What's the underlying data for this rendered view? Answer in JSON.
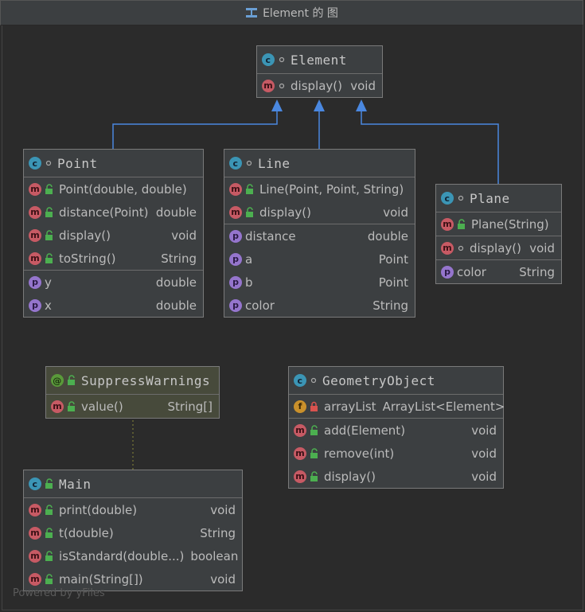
{
  "window": {
    "title": "Element 的 图"
  },
  "footer": {
    "text": "Powered by yFiles"
  },
  "colors": {
    "edge_inherit": "#4a88e0",
    "edge_dep": "#8a8a3a",
    "class_badge": "#3b95b5",
    "method_badge": "#c75a64",
    "property_badge": "#9575cd",
    "field_badge": "#c9902b",
    "annotation_badge": "#5a9a3a"
  },
  "nodes": {
    "element": {
      "name": "Element",
      "rows": [
        {
          "name": "display()",
          "type": "void"
        }
      ]
    },
    "point": {
      "name": "Point",
      "methods": [
        {
          "name": "Point(double, double)",
          "type": ""
        },
        {
          "name": "distance(Point)",
          "type": "double"
        },
        {
          "name": "display()",
          "type": "void"
        },
        {
          "name": "toString()",
          "type": "String"
        }
      ],
      "props": [
        {
          "name": "y",
          "type": "double"
        },
        {
          "name": "x",
          "type": "double"
        }
      ]
    },
    "line": {
      "name": "Line",
      "methods": [
        {
          "name": "Line(Point, Point, String)",
          "type": ""
        },
        {
          "name": "display()",
          "type": "void"
        }
      ],
      "props": [
        {
          "name": "distance",
          "type": "double"
        },
        {
          "name": "a",
          "type": "Point"
        },
        {
          "name": "b",
          "type": "Point"
        },
        {
          "name": "color",
          "type": "String"
        }
      ]
    },
    "plane": {
      "name": "Plane",
      "ctor": {
        "name": "Plane(String)",
        "type": ""
      },
      "methods": [
        {
          "name": "display()",
          "type": "void"
        }
      ],
      "props": [
        {
          "name": "color",
          "type": "String"
        }
      ]
    },
    "suppress": {
      "name": "SuppressWarnings",
      "rows": [
        {
          "name": "value()",
          "type": "String[]"
        }
      ]
    },
    "geometry": {
      "name": "GeometryObject",
      "fields": [
        {
          "name": "arrayList",
          "type": "ArrayList<Element>"
        }
      ],
      "methods": [
        {
          "name": "add(Element)",
          "type": "void"
        },
        {
          "name": "remove(int)",
          "type": "void"
        },
        {
          "name": "display()",
          "type": "void"
        }
      ]
    },
    "main": {
      "name": "Main",
      "methods": [
        {
          "name": "print(double)",
          "type": "void"
        },
        {
          "name": "t(double)",
          "type": "String"
        },
        {
          "name": "isStandard(double...)",
          "type": "boolean"
        },
        {
          "name": "main(String[])",
          "type": "void"
        }
      ]
    }
  },
  "icons": {
    "class": "c",
    "method": "m",
    "property": "p",
    "field": "f",
    "annotation": "@"
  }
}
